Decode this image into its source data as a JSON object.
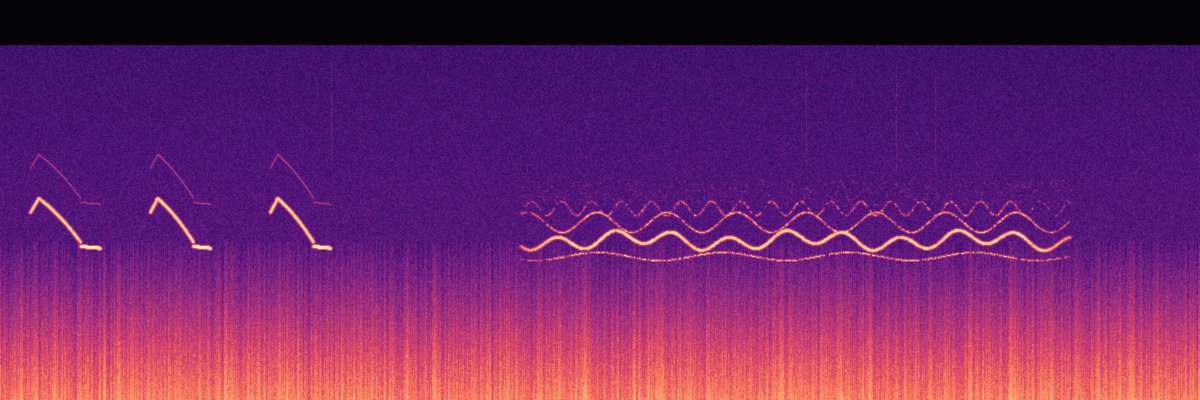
{
  "spectrogram": {
    "palette": [
      "#000004",
      "#1d1147",
      "#3b0f70",
      "#5a167e",
      "#7b2382",
      "#9e2f7f",
      "#c23b75",
      "#e34e65",
      "#f7705c",
      "#fd9a6a",
      "#fec287",
      "#fcfdbf"
    ],
    "background_top_color": "#040306",
    "calls": [
      {
        "kind": "descending-sweep",
        "start_s": 0.3,
        "end_s": 1.0
      },
      {
        "kind": "descending-sweep",
        "start_s": 1.5,
        "end_s": 2.1
      },
      {
        "kind": "descending-sweep",
        "start_s": 2.7,
        "end_s": 3.3
      },
      {
        "kind": "dense-chorus",
        "start_s": 5.2,
        "end_s": 10.7
      }
    ]
  }
}
